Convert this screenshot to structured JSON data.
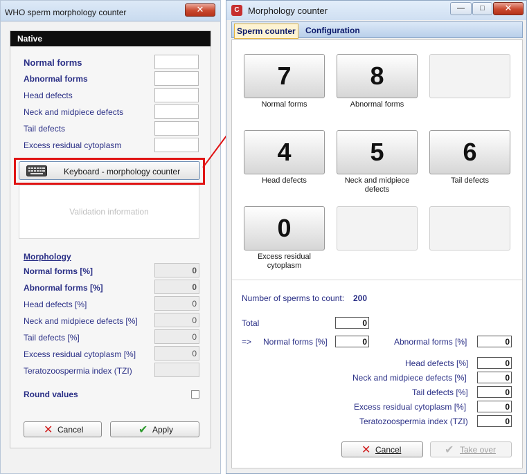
{
  "left_window": {
    "title": "WHO sperm morphology counter",
    "close_glyph": "✕",
    "panel_title": "Native",
    "input_rows": [
      {
        "label": "Normal forms"
      },
      {
        "label": "Abnormal forms"
      },
      {
        "label": "Head defects"
      },
      {
        "label": "Neck and midpiece defects"
      },
      {
        "label": "Tail defects"
      },
      {
        "label": "Excess residual cytoplasm"
      }
    ],
    "keyboard_button": "Keyboard - morphology counter",
    "validation_placeholder": "Validation information",
    "morphology_heading": "Morphology",
    "morphology_rows": [
      {
        "label": "Normal forms [%]",
        "value": "0"
      },
      {
        "label": "Abnormal forms [%]",
        "value": "0"
      },
      {
        "label": "Head defects [%]",
        "value": "0"
      },
      {
        "label": "Neck and midpiece defects [%]",
        "value": "0"
      },
      {
        "label": "Tail defects [%]",
        "value": "0"
      },
      {
        "label": "Excess residual cytoplasm [%]",
        "value": "0"
      },
      {
        "label": "Teratozoospermia index (TZI)",
        "value": ""
      }
    ],
    "round_values_label": "Round values",
    "round_values_checked": false,
    "cancel_label": "Cancel",
    "apply_label": "Apply"
  },
  "right_window": {
    "title": "Morphology counter",
    "app_icon_letter": "C",
    "minimize_glyph": "—",
    "maximize_glyph": "□",
    "close_glyph": "✕",
    "tabs": [
      "Sperm counter",
      "Configuration"
    ],
    "active_tab": "Sperm counter",
    "counters": [
      {
        "value": "7",
        "caption": "Normal forms"
      },
      {
        "value": "8",
        "caption": "Abnormal forms"
      },
      {
        "value": "",
        "caption": ""
      },
      {
        "value": "4",
        "caption": "Head defects"
      },
      {
        "value": "5",
        "caption": "Neck and midpiece defects"
      },
      {
        "value": "6",
        "caption": "Tail defects"
      },
      {
        "value": "0",
        "caption": "Excess residual cytoplasm"
      },
      {
        "value": "",
        "caption": ""
      },
      {
        "value": "",
        "caption": ""
      }
    ],
    "sperms_to_count_label": "Number of sperms to count:",
    "sperms_to_count_value": "200",
    "total_label": "Total",
    "total_value": "0",
    "arrow_label": "=>",
    "normal_pct_label": "Normal forms [%]",
    "normal_pct_value": "0",
    "abnormal_pct_label": "Abnormal forms [%]",
    "abnormal_pct_value": "0",
    "detail_rows": [
      {
        "label": "Head defects [%]",
        "value": "0"
      },
      {
        "label": "Neck and midpiece defects [%]",
        "value": "0"
      },
      {
        "label": "Tail defects [%]",
        "value": "0"
      },
      {
        "label": "Excess residual cytoplasm [%]",
        "value": "0"
      },
      {
        "label": "Teratozoospermia index (TZI)",
        "value": "0"
      }
    ],
    "cancel_label": "Cancel",
    "take_over_label": "Take over"
  },
  "colors": {
    "label_blue": "#2a2f86",
    "highlight_red": "#e01414",
    "panel_header": "#0e0e0e"
  }
}
